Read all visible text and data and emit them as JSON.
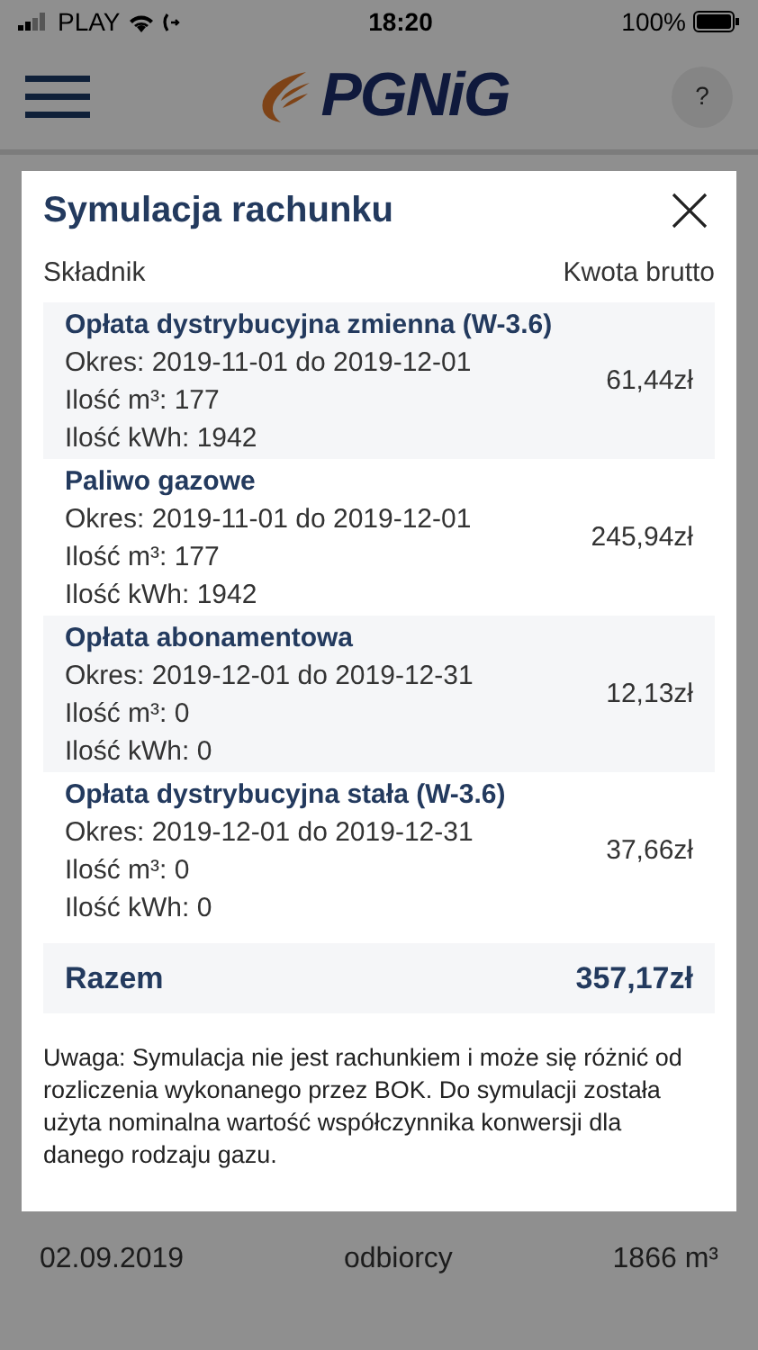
{
  "status_bar": {
    "carrier": "PLAY",
    "time": "18:20",
    "battery": "100%"
  },
  "header": {
    "logo": "PGNiG",
    "help": "?"
  },
  "background_row": [
    "02.09.2019",
    "odbiorcy",
    "1866 m³"
  ],
  "modal": {
    "title": "Symulacja rachunku",
    "columns": [
      "Składnik",
      "Kwota brutto"
    ],
    "items": [
      {
        "name": "Opłata dystrybucyjna zmienna (W-3.6)",
        "lines": [
          "Okres: 2019-11-01 do 2019-12-01",
          "Ilość m³: 177",
          "Ilość kWh: 1942"
        ],
        "amount": "61,44zł"
      },
      {
        "name": "Paliwo gazowe",
        "lines": [
          "Okres: 2019-11-01 do 2019-12-01",
          "Ilość m³: 177",
          "Ilość kWh: 1942"
        ],
        "amount": "245,94zł"
      },
      {
        "name": "Opłata abonamentowa",
        "lines": [
          "Okres: 2019-12-01 do 2019-12-31",
          "Ilość m³: 0",
          "Ilość kWh: 0"
        ],
        "amount": "12,13zł"
      },
      {
        "name": "Opłata dystrybucyjna stała (W-3.6)",
        "lines": [
          "Okres: 2019-12-01 do 2019-12-31",
          "Ilość m³: 0",
          "Ilość kWh: 0"
        ],
        "amount": "37,66zł"
      }
    ],
    "total": {
      "label": "Razem",
      "amount": "357,17zł"
    },
    "note": "Uwaga: Symulacja nie jest rachunkiem i może się różnić od rozliczenia wykonanego przez BOK. Do symulacji została użyta nominalna wartość współczynnika konwersji dla danego rodzaju gazu."
  }
}
